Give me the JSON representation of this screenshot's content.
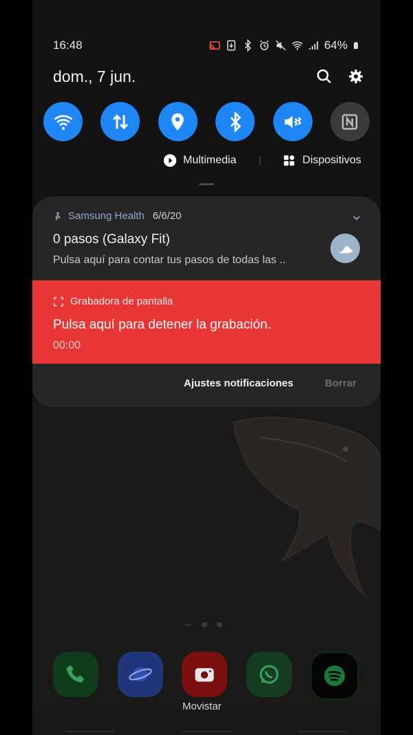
{
  "status_bar": {
    "time": "16:48",
    "battery": "64%"
  },
  "header": {
    "date": "dom., 7 jun."
  },
  "quick_settings": [
    {
      "name": "wifi",
      "icon": "wifi-icon",
      "on": true
    },
    {
      "name": "mobile-data",
      "icon": "data-arrows-icon",
      "on": true
    },
    {
      "name": "location",
      "icon": "location-pin-icon",
      "on": true
    },
    {
      "name": "bluetooth",
      "icon": "bluetooth-icon",
      "on": true
    },
    {
      "name": "sound",
      "icon": "vibrate-mute-icon",
      "on": true
    },
    {
      "name": "nfc",
      "icon": "nfc-icon",
      "on": false
    }
  ],
  "media_row": {
    "multimedia": "Multimedia",
    "devices": "Dispositivos"
  },
  "notifications": {
    "health": {
      "app": "Samsung Health",
      "date": "6/6/20",
      "title": "0 pasos (Galaxy Fit)",
      "text": "Pulsa aquí para contar tus pasos de todas las .."
    },
    "recorder": {
      "app": "Grabadora de pantalla",
      "title": "Pulsa aquí para detener la grabación.",
      "time": "00:00"
    },
    "actions": {
      "settings": "Ajustes notificaciones",
      "clear": "Borrar"
    }
  },
  "dock": {
    "label": "Movistar"
  },
  "colors": {
    "accent": "#1e86f5",
    "recorder": "#e83535",
    "panel": "#262626"
  }
}
